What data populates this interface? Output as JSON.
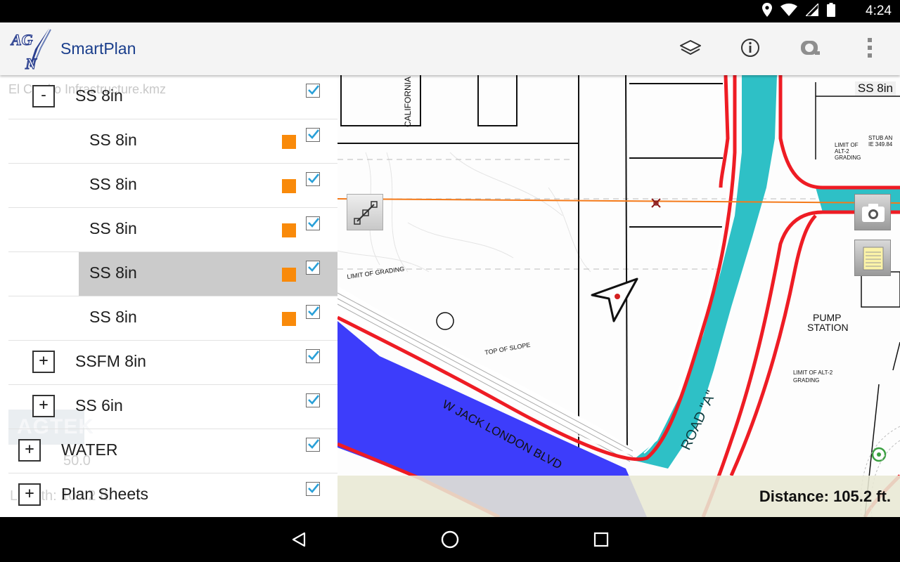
{
  "status_bar": {
    "time": "4:24",
    "icons": [
      "location-icon",
      "wifi-icon",
      "signal-icon",
      "battery-icon"
    ]
  },
  "app_bar": {
    "title": "SmartPlan",
    "actions": [
      "layers-icon",
      "info-icon",
      "tape-measure-icon",
      "overflow-menu-icon"
    ]
  },
  "layers_panel": {
    "background_filename": "El Cerrito Infrastructure.kmz",
    "background_value": "50.0",
    "background_length": "Length: 105.2 ft.",
    "rows": [
      {
        "label": "SS 8in",
        "expander": "-",
        "checked": true
      },
      {
        "label": "SS 8in",
        "swatch_color": "#f98a0a",
        "checked": true
      },
      {
        "label": "SS 8in",
        "swatch_color": "#f98a0a",
        "checked": true
      },
      {
        "label": "SS 8in",
        "swatch_color": "#f98a0a",
        "checked": true
      },
      {
        "label": "SS 8in",
        "swatch_color": "#f98a0a",
        "checked": true,
        "selected": true
      },
      {
        "label": "SS 8in",
        "swatch_color": "#f98a0a",
        "checked": true
      },
      {
        "label": "SSFM 8in",
        "expander": "+",
        "checked": true
      },
      {
        "label": "SS 6in",
        "expander": "+",
        "checked": true
      },
      {
        "label": "WATER",
        "expander": "+",
        "checked": true
      },
      {
        "label": "Plan Sheets",
        "expander": "+",
        "checked": true
      }
    ]
  },
  "map": {
    "layer_badge": "SS 8in",
    "distance": "Distance: 105.2 ft.",
    "labels": {
      "california": "CALIFORNIA",
      "limit_grading_left": "LIMIT OF GRADING",
      "top_of_slope": "TOP OF SLOPE",
      "street": "W JACK LONDON BLVD",
      "road": "ROAD \"A\"",
      "pump_1": "PUMP",
      "pump_2": "STATION",
      "limit_alt_right_1": "LIMIT OF ALT-2",
      "limit_alt_right_2": "GRADING",
      "limit_alt_top_1": "LIMIT OF",
      "limit_alt_top_2": "ALT-2",
      "limit_alt_top_3": "GRADING",
      "stub_1": "STUB AN",
      "stub_2": "IE 349.84"
    },
    "colors": {
      "road_fill": "#2ec0c6",
      "blvd_fill": "#3d3dfb",
      "curb": "#ee1c24",
      "sewer_line": "#f47a1a"
    }
  },
  "nav_bar": {
    "buttons": [
      "back-icon",
      "home-icon",
      "recents-icon"
    ]
  }
}
